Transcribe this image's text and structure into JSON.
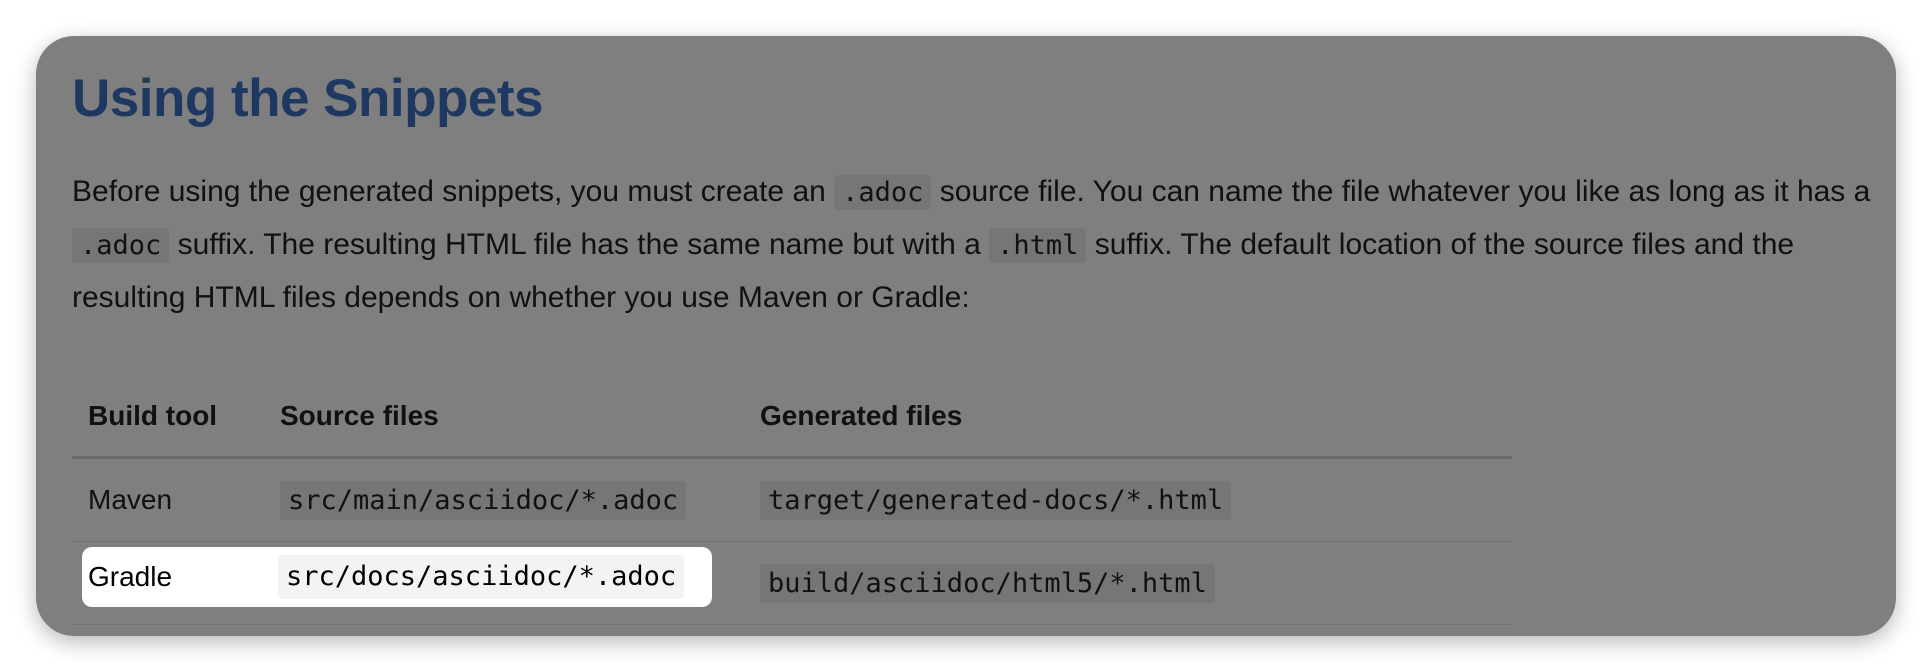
{
  "section": {
    "title": "Using the Snippets",
    "paragraph": {
      "t1": "Before using the generated snippets, you must create an ",
      "c1": ".adoc",
      "t2": " source file. You can name the file whatever you like as long as it has a ",
      "c2": ".adoc",
      "t3": " suffix. The resulting HTML file has the same name but with a ",
      "c3": ".html",
      "t4": " suffix. The default location of the source files and the resulting HTML files depends on whether you use Maven or Gradle:"
    }
  },
  "table": {
    "headers": [
      "Build tool",
      "Source files",
      "Generated files"
    ],
    "rows": [
      {
        "tool": "Maven",
        "source": "src/main/asciidoc/*.adoc",
        "generated": "target/generated-docs/*.html"
      },
      {
        "tool": "Gradle",
        "source": "src/docs/asciidoc/*.adoc",
        "generated": "build/asciidoc/html5/*.html"
      }
    ]
  },
  "highlight": {
    "row_index": 1
  },
  "colors": {
    "title": "#3d70c4",
    "overlay": "rgba(0,0,0,0.5)",
    "code_background": "#ececec"
  }
}
